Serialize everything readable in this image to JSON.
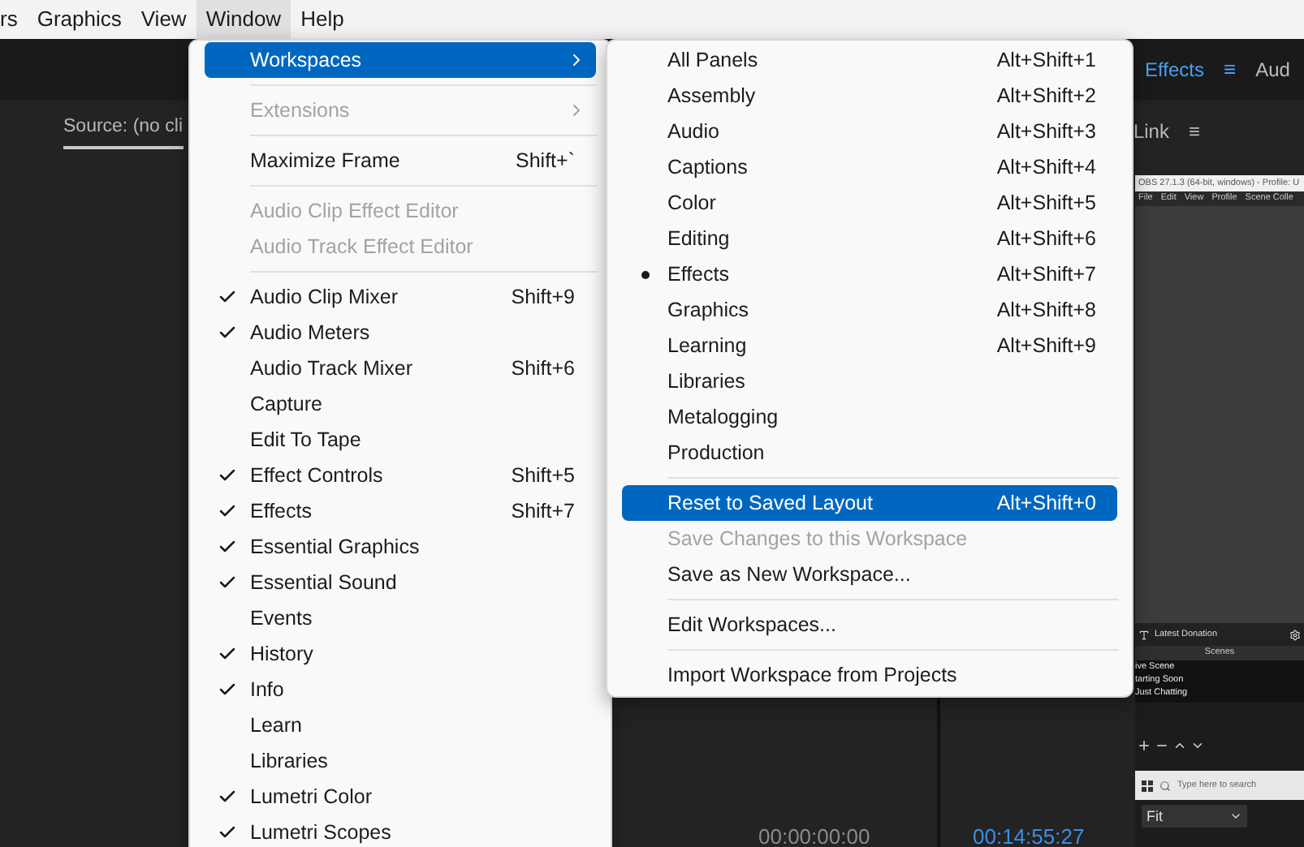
{
  "menu_bar": [
    {
      "label": "rs",
      "selected": false
    },
    {
      "label": "Graphics",
      "selected": false
    },
    {
      "label": "View",
      "selected": false
    },
    {
      "label": "Window",
      "selected": true
    },
    {
      "label": "Help",
      "selected": false
    }
  ],
  "panel_header": {
    "tab": "Effects",
    "menu": "≡",
    "next_tab": "Aud"
  },
  "source_tab": {
    "label": "Source: (no cli",
    "selected": true
  },
  "link_tab": {
    "label": "Link",
    "menu": "≡"
  },
  "timecodes": [
    {
      "text": "00:00:00:00",
      "kind": "source"
    },
    {
      "text": "00:14:55:27",
      "kind": "program"
    }
  ],
  "obs_window": {
    "title": "OBS 27.1.3 (64-bit, windows) - Profile: U",
    "menu": [
      "File",
      "Edit",
      "View",
      "Profile",
      "Scene Colle"
    ],
    "source_label": "Latest Donation",
    "scenes_header": "Scenes",
    "scenes": [
      "ive Scene",
      "tarting Soon",
      "Just Chatting"
    ],
    "search_placeholder": "Type here to search",
    "scale": "Fit"
  },
  "window_menu": [
    {
      "kind": "item",
      "label": "Workspaces",
      "submenu": true,
      "selected": true,
      "disabled": false,
      "checked": false
    },
    {
      "kind": "separator"
    },
    {
      "kind": "item",
      "label": "Extensions",
      "submenu": true,
      "selected": false,
      "disabled": true,
      "checked": false
    },
    {
      "kind": "separator"
    },
    {
      "kind": "item",
      "label": "Maximize Frame",
      "shortcut": "Shift+`",
      "selected": false,
      "disabled": false,
      "checked": false
    },
    {
      "kind": "separator"
    },
    {
      "kind": "item",
      "label": "Audio Clip Effect Editor",
      "selected": false,
      "disabled": true,
      "checked": false
    },
    {
      "kind": "item",
      "label": "Audio Track Effect Editor",
      "selected": false,
      "disabled": true,
      "checked": false
    },
    {
      "kind": "separator"
    },
    {
      "kind": "item",
      "label": "Audio Clip Mixer",
      "shortcut": "Shift+9",
      "selected": false,
      "disabled": false,
      "checked": true
    },
    {
      "kind": "item",
      "label": "Audio Meters",
      "selected": false,
      "disabled": false,
      "checked": true
    },
    {
      "kind": "item",
      "label": "Audio Track Mixer",
      "shortcut": "Shift+6",
      "selected": false,
      "disabled": false,
      "checked": false
    },
    {
      "kind": "item",
      "label": "Capture",
      "selected": false,
      "disabled": false,
      "checked": false
    },
    {
      "kind": "item",
      "label": "Edit To Tape",
      "selected": false,
      "disabled": false,
      "checked": false
    },
    {
      "kind": "item",
      "label": "Effect Controls",
      "shortcut": "Shift+5",
      "selected": false,
      "disabled": false,
      "checked": true
    },
    {
      "kind": "item",
      "label": "Effects",
      "shortcut": "Shift+7",
      "selected": false,
      "disabled": false,
      "checked": true
    },
    {
      "kind": "item",
      "label": "Essential Graphics",
      "selected": false,
      "disabled": false,
      "checked": true
    },
    {
      "kind": "item",
      "label": "Essential Sound",
      "selected": false,
      "disabled": false,
      "checked": true
    },
    {
      "kind": "item",
      "label": "Events",
      "selected": false,
      "disabled": false,
      "checked": false
    },
    {
      "kind": "item",
      "label": "History",
      "selected": false,
      "disabled": false,
      "checked": true
    },
    {
      "kind": "item",
      "label": "Info",
      "selected": false,
      "disabled": false,
      "checked": true
    },
    {
      "kind": "item",
      "label": "Learn",
      "selected": false,
      "disabled": false,
      "checked": false
    },
    {
      "kind": "item",
      "label": "Libraries",
      "selected": false,
      "disabled": false,
      "checked": false
    },
    {
      "kind": "item",
      "label": "Lumetri Color",
      "selected": false,
      "disabled": false,
      "checked": true
    },
    {
      "kind": "item",
      "label": "Lumetri Scopes",
      "selected": false,
      "disabled": false,
      "checked": true
    }
  ],
  "workspaces_menu": [
    {
      "kind": "item",
      "label": "All Panels",
      "shortcut": "Alt+Shift+1",
      "selected": false,
      "disabled": false,
      "checked": false
    },
    {
      "kind": "item",
      "label": "Assembly",
      "shortcut": "Alt+Shift+2",
      "selected": false,
      "disabled": false,
      "checked": false
    },
    {
      "kind": "item",
      "label": "Audio",
      "shortcut": "Alt+Shift+3",
      "selected": false,
      "disabled": false,
      "checked": false
    },
    {
      "kind": "item",
      "label": "Captions",
      "shortcut": "Alt+Shift+4",
      "selected": false,
      "disabled": false,
      "checked": false
    },
    {
      "kind": "item",
      "label": "Color",
      "shortcut": "Alt+Shift+5",
      "selected": false,
      "disabled": false,
      "checked": false
    },
    {
      "kind": "item",
      "label": "Editing",
      "shortcut": "Alt+Shift+6",
      "selected": false,
      "disabled": false,
      "checked": false
    },
    {
      "kind": "item",
      "label": "Effects",
      "shortcut": "Alt+Shift+7",
      "selected": false,
      "disabled": false,
      "checked": true
    },
    {
      "kind": "item",
      "label": "Graphics",
      "shortcut": "Alt+Shift+8",
      "selected": false,
      "disabled": false,
      "checked": false
    },
    {
      "kind": "item",
      "label": "Learning",
      "shortcut": "Alt+Shift+9",
      "selected": false,
      "disabled": false,
      "checked": false
    },
    {
      "kind": "item",
      "label": "Libraries",
      "selected": false,
      "disabled": false,
      "checked": false
    },
    {
      "kind": "item",
      "label": "Metalogging",
      "selected": false,
      "disabled": false,
      "checked": false
    },
    {
      "kind": "item",
      "label": "Production",
      "selected": false,
      "disabled": false,
      "checked": false
    },
    {
      "kind": "separator"
    },
    {
      "kind": "item",
      "label": "Reset to Saved Layout",
      "shortcut": "Alt+Shift+0",
      "selected": true,
      "disabled": false,
      "checked": false
    },
    {
      "kind": "item",
      "label": "Save Changes to this Workspace",
      "selected": false,
      "disabled": true,
      "checked": false
    },
    {
      "kind": "item",
      "label": "Save as New Workspace...",
      "selected": false,
      "disabled": false,
      "checked": false
    },
    {
      "kind": "separator"
    },
    {
      "kind": "item",
      "label": "Edit Workspaces...",
      "selected": false,
      "disabled": false,
      "checked": false
    },
    {
      "kind": "separator"
    },
    {
      "kind": "item",
      "label": "Import Workspace from Projects",
      "selected": false,
      "disabled": false,
      "checked": false
    }
  ]
}
